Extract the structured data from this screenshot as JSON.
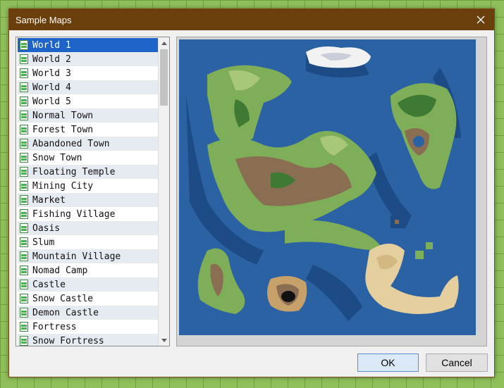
{
  "window": {
    "title": "Sample Maps"
  },
  "map_list": {
    "selected_index": 0,
    "items": [
      "World 1",
      "World 2",
      "World 3",
      "World 4",
      "World 5",
      "Normal Town",
      "Forest Town",
      "Abandoned Town",
      "Snow Town",
      "Floating Temple",
      "Mining City",
      "Market",
      "Fishing Village",
      "Oasis",
      "Slum",
      "Mountain Village",
      "Nomad Camp",
      "Castle",
      "Snow Castle",
      "Demon Castle",
      "Fortress",
      "Snow Fortress"
    ],
    "icon": "map-file-icon"
  },
  "preview": {
    "icon": "world-map-preview"
  },
  "buttons": {
    "ok": "OK",
    "cancel": "Cancel"
  },
  "colors": {
    "titlebar": "#6b3f0c",
    "selection": "#1e64c8",
    "ocean": "#2a62a4",
    "deep_water": "#1d4b86",
    "grass": "#7fae58",
    "forest": "#3f7a34",
    "mountain": "#8a6e52",
    "sand": "#e6cf9f"
  }
}
